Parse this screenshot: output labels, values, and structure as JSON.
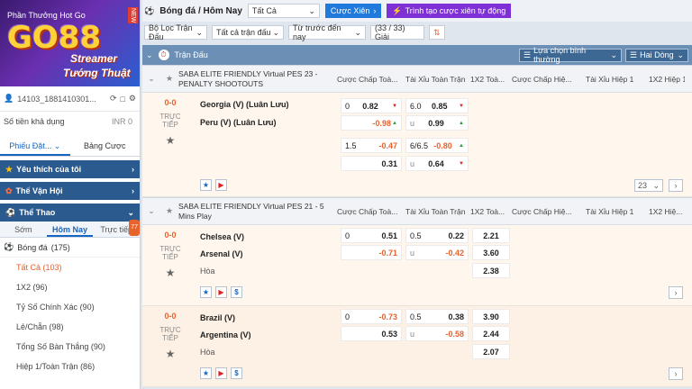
{
  "sidebar": {
    "banner_top": "Phần Thưởng Hot Go",
    "logo": "GO88",
    "sub1": "Streamer",
    "sub2": "Tướng Thuật",
    "new_badge": "NEW",
    "account": "14103_1881410301...",
    "balance_label": "Số tiền khả dụng",
    "balance_value": "INR 0",
    "tabs": [
      "Phiếu Đặt...",
      "Bảng Cược"
    ],
    "sections": [
      {
        "label": "Yêu thích của tôi",
        "icon": "star-icon"
      },
      {
        "label": "Thế Vận Hội",
        "icon": "torch-icon"
      },
      {
        "label": "Thể Thao",
        "icon": "ball-icon"
      }
    ],
    "date_tabs": [
      "Sớm",
      "Hôm Nay",
      "Trực tiếp"
    ],
    "live_count": "77",
    "sport": "Bóng đá",
    "sport_count": "(175)",
    "subitems": [
      {
        "label": "Tất Cả",
        "count": "(103)"
      },
      {
        "label": "1X2",
        "count": "(96)"
      },
      {
        "label": "Tỷ Số Chính Xác",
        "count": "(90)"
      },
      {
        "label": "Lẻ/Chẵn",
        "count": "(98)"
      },
      {
        "label": "Tổng Số Bàn Thắng",
        "count": "(90)"
      },
      {
        "label": "Hiệp 1/Toàn Trận",
        "count": "(86)"
      }
    ]
  },
  "toolbar": {
    "title": "Bóng đá / Hôm Nay",
    "filter": "Tất Cả",
    "combo": "Cược Xiên",
    "auto_combo": "Trình tạo cược xiên tự động",
    "league_filter": "Bộ Lọc Trận Đấu",
    "all_matches": "Tất cả trận đấu",
    "time_filter": "Từ trước đến nay",
    "league_count": "(33 / 33) Giải"
  },
  "section": {
    "title": "Trận Đấu",
    "odds_type": "Lựa chọn bình thường",
    "line_type": "Hai Dòng"
  },
  "groups": [
    {
      "league": "SABA ELITE FRIENDLY Virtual PES 23 - PENALTY SHOOTOUTS",
      "headers": [
        "Cược Chấp Toà...",
        "Tài Xỉu Toàn Trận",
        "1X2 Toà...",
        "Cược Chấp Hiệ...",
        "Tài Xỉu Hiệp 1",
        "1X2 Hiệp 1"
      ],
      "matches": [
        {
          "score": "0-0",
          "live": "TRỰC TIẾP",
          "home": "Georgia (V) (Luân Lưu)",
          "away": "Peru (V) (Luân Lưu)",
          "page": "23",
          "lines": [
            {
              "hdp_line": "0",
              "hdp_home": "0.82",
              "hdp_away": "-0.98",
              "ou_line": "6.0",
              "ou_over": "0.85",
              "ou_u": "u",
              "ou_under": "0.99"
            },
            {
              "hdp_line": "1.5",
              "hdp_home": "-0.47",
              "hdp_away": "0.31",
              "ou_line": "6/6.5",
              "ou_over": "-0.80",
              "ou_u": "u",
              "ou_under": "0.64"
            }
          ]
        }
      ]
    },
    {
      "league": "SABA ELITE FRIENDLY Virtual PES 21 - 5 Mins Play",
      "headers": [
        "Cược Chấp Toà...",
        "Tài Xỉu Toàn Trận",
        "1X2 Toà...",
        "Cược Chấp Hiệ...",
        "Tài Xỉu Hiệp 1",
        "1X2 Hiệ..."
      ],
      "matches": [
        {
          "score": "0-0",
          "live": "TRỰC TIẾP",
          "home": "Chelsea (V)",
          "away": "Arsenal (V)",
          "draw": "Hòa",
          "hdp_line": "0",
          "hdp_home": "0.51",
          "hdp_away": "-0.71",
          "ou_line": "0.5",
          "ou_over": "0.22",
          "ou_u": "u",
          "ou_under": "-0.42",
          "x1": "2.21",
          "x2": "3.60",
          "xd": "2.38"
        },
        {
          "score": "0-0",
          "live": "TRỰC TIẾP",
          "home": "Brazil (V)",
          "away": "Argentina (V)",
          "draw": "Hòa",
          "hdp_line": "0",
          "hdp_home": "-0.73",
          "hdp_away": "0.53",
          "ou_line": "0.5",
          "ou_over": "0.38",
          "ou_u": "u",
          "ou_under": "-0.58",
          "x1": "3.90",
          "x2": "2.44",
          "xd": "2.07"
        }
      ]
    }
  ]
}
